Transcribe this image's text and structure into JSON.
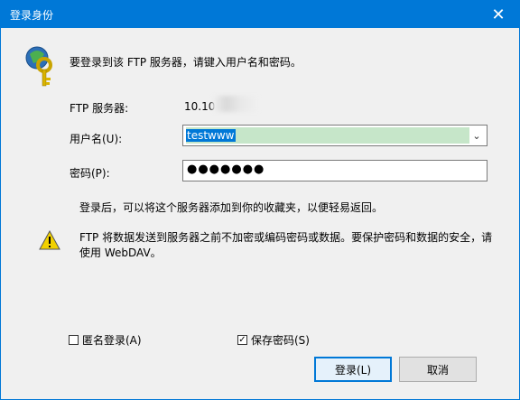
{
  "window": {
    "title": "登录身份"
  },
  "prompt": "要登录到该 FTP 服务器，请键入用户名和密码。",
  "server": {
    "label": "FTP 服务器:",
    "value": "10.10"
  },
  "username": {
    "label": "用户名(U):",
    "value": "testwww"
  },
  "password": {
    "label": "密码(P):",
    "masked": "●●●●●●●"
  },
  "info": "登录后，可以将这个服务器添加到你的收藏夹，以便轻易返回。",
  "warning": "FTP 将数据发送到服务器之前不加密或编码密码或数据。要保护密码和数据的安全，请使用 WebDAV。",
  "options": {
    "anonymous": {
      "label": "匿名登录(A)",
      "checked": false
    },
    "save_password": {
      "label": "保存密码(S)",
      "checked": true
    }
  },
  "buttons": {
    "login": "登录(L)",
    "cancel": "取消"
  },
  "colors": {
    "accent": "#0078d7",
    "warning": "#f2d100"
  },
  "icons": {
    "title_close": "close-icon",
    "key": "key-icon",
    "warning": "warning-icon"
  }
}
